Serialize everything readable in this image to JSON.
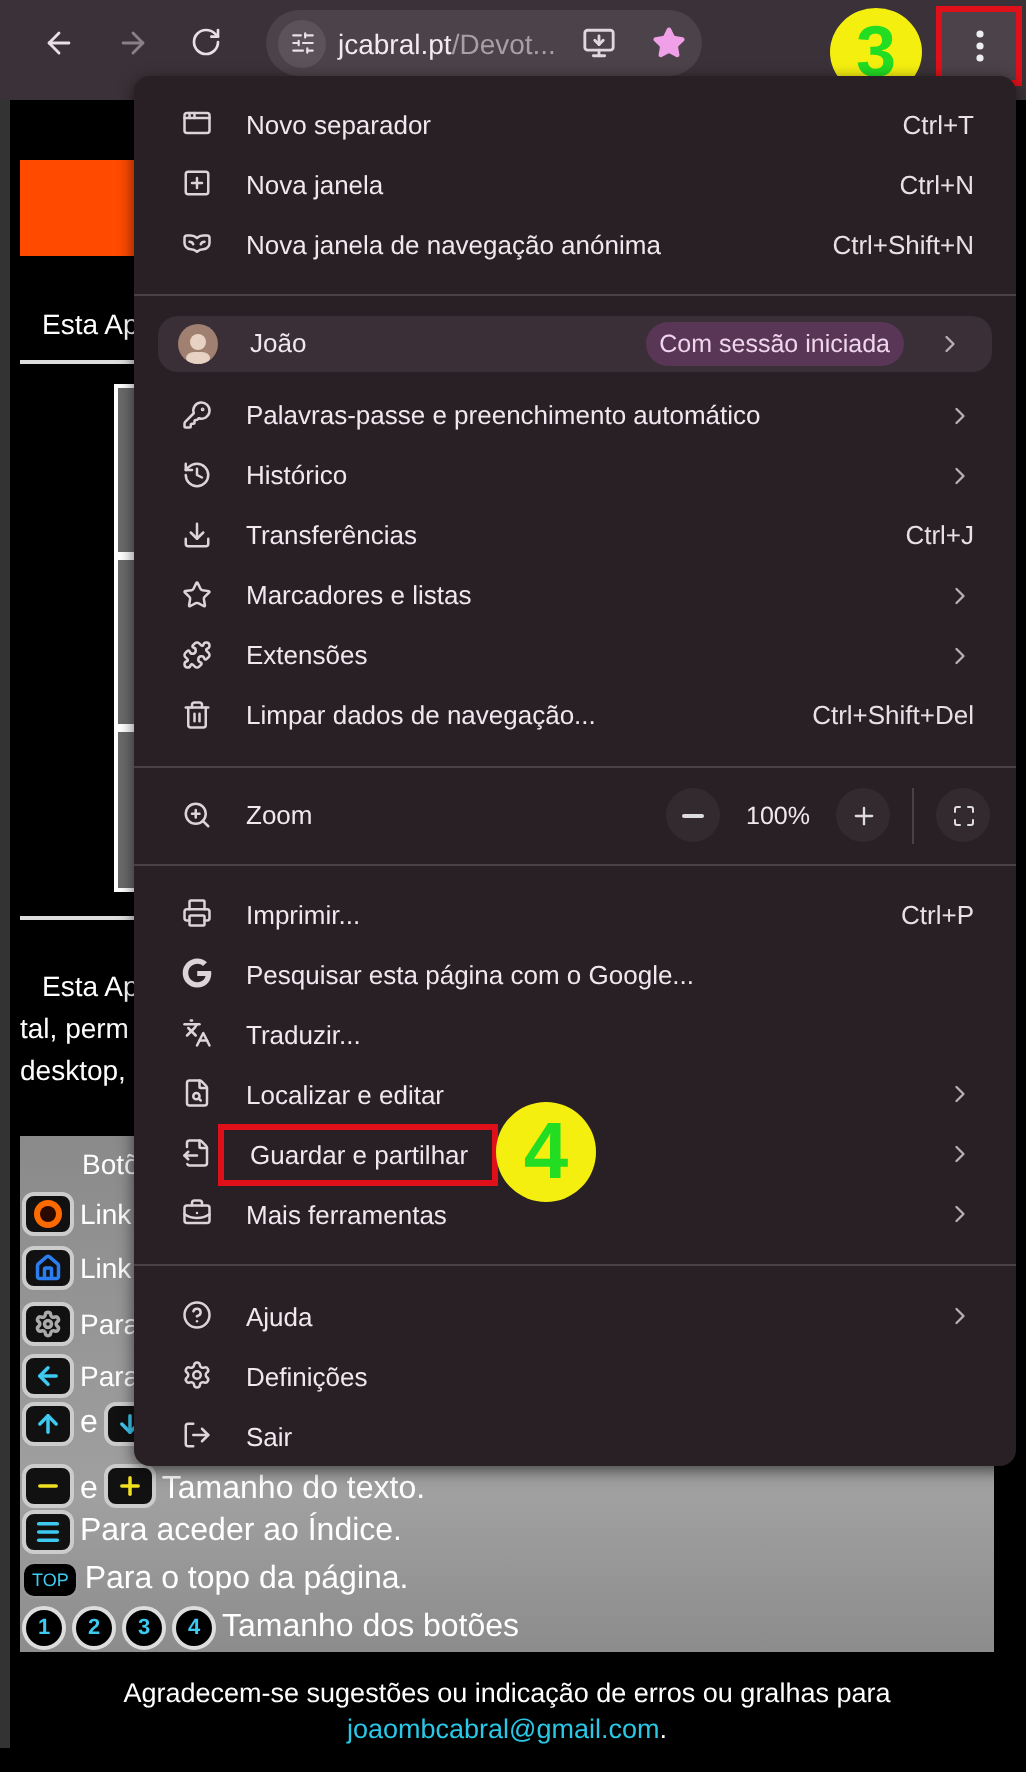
{
  "toolbar": {
    "url_domain": "jcabral.pt",
    "url_path": "/Devot...",
    "bookmarked": true,
    "annotation": "3"
  },
  "page": {
    "intro_top": "Esta Ap",
    "intro_lines": [
      "Esta Ap",
      "tal, perm",
      "desktop,"
    ],
    "legend_title": "Botõ",
    "legend_rows": [
      {
        "parts": [
          {
            "kind": "icon"
          },
          {
            "kind": "text",
            "text": "Link"
          }
        ]
      },
      {
        "parts": [
          {
            "kind": "icon"
          },
          {
            "kind": "text",
            "text": "Link"
          }
        ]
      },
      {
        "parts": [
          {
            "kind": "icon"
          },
          {
            "kind": "text",
            "text": "Para"
          }
        ]
      },
      {
        "parts": [
          {
            "kind": "icon"
          },
          {
            "kind": "text",
            "text": "Para"
          }
        ]
      },
      {
        "parts": [
          {
            "kind": "icon"
          },
          {
            "kind": "text",
            "text": "e"
          },
          {
            "kind": "icon"
          }
        ]
      },
      {
        "parts": [
          {
            "kind": "icon"
          },
          {
            "kind": "text",
            "text": "e"
          },
          {
            "kind": "icon"
          },
          {
            "kind": "text",
            "text": "Tamanho do texto."
          }
        ]
      },
      {
        "parts": [
          {
            "kind": "icon"
          },
          {
            "kind": "text",
            "text": "Para aceder ao Índice."
          }
        ]
      },
      {
        "parts": [
          {
            "kind": "key",
            "text": "TOP"
          },
          {
            "kind": "text",
            "text": "Para o topo da página."
          }
        ]
      },
      {
        "parts": [
          {
            "kind": "number",
            "text": "1"
          },
          {
            "kind": "number",
            "text": "2"
          },
          {
            "kind": "number",
            "text": "3"
          },
          {
            "kind": "number",
            "text": "4"
          },
          {
            "kind": "text",
            "text": "Tamanho dos botões"
          }
        ]
      }
    ],
    "footer": {
      "text": "Agradecem-se sugestões ou indicação de erros ou gralhas para",
      "email": "joaombcabral@gmail.com",
      "end": "."
    }
  },
  "menu": {
    "sections": [
      {
        "kind": "items",
        "items": [
          {
            "label": "Novo separador",
            "shortcut": "Ctrl+T",
            "submenu": false
          },
          {
            "label": "Nova janela",
            "shortcut": "Ctrl+N",
            "submenu": false
          },
          {
            "label": "Nova janela de navegação anónima",
            "shortcut": "Ctrl+Shift+N",
            "submenu": false
          }
        ]
      },
      {
        "kind": "profile",
        "name": "João",
        "badge": "Com sessão iniciada"
      },
      {
        "kind": "items",
        "items": [
          {
            "label": "Palavras-passe e preenchimento automático",
            "submenu": true
          },
          {
            "label": "Histórico",
            "submenu": true
          },
          {
            "label": "Transferências",
            "shortcut": "Ctrl+J",
            "submenu": false
          },
          {
            "label": "Marcadores e listas",
            "submenu": true
          },
          {
            "label": "Extensões",
            "submenu": true
          },
          {
            "label": "Limpar dados de navegação...",
            "shortcut": "Ctrl+Shift+Del",
            "submenu": false
          }
        ]
      },
      {
        "kind": "zoom",
        "label": "Zoom",
        "value": "100%"
      },
      {
        "kind": "items",
        "items": [
          {
            "label": "Imprimir...",
            "shortcut": "Ctrl+P",
            "submenu": false
          },
          {
            "label": "Pesquisar esta página com o Google...",
            "submenu": false
          },
          {
            "label": "Traduzir...",
            "submenu": false
          },
          {
            "label": "Localizar e editar",
            "submenu": true
          },
          {
            "label": "Guardar e partilhar",
            "submenu": true,
            "annotation": "4"
          },
          {
            "label": "Mais ferramentas",
            "submenu": true
          }
        ]
      },
      {
        "kind": "items",
        "items": [
          {
            "label": "Ajuda",
            "submenu": true
          },
          {
            "label": "Definições",
            "submenu": false
          },
          {
            "label": "Sair",
            "submenu": false
          }
        ]
      }
    ]
  }
}
